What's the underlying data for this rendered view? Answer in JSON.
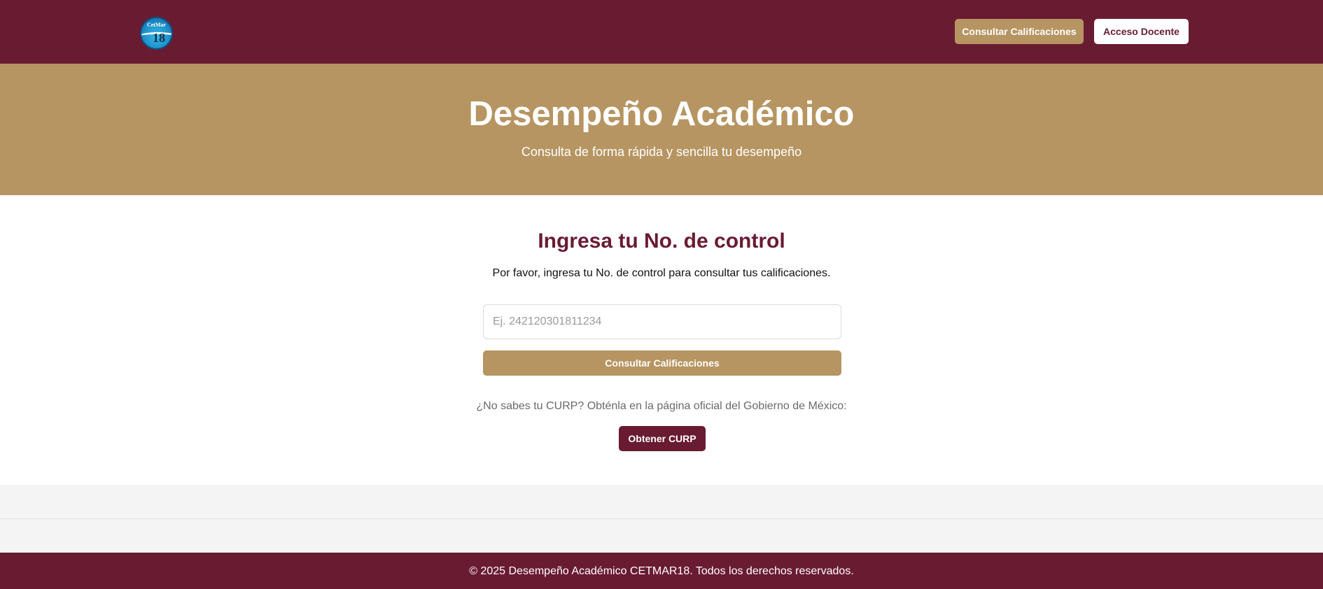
{
  "header": {
    "logo": {
      "icon": "cetmar-logo",
      "text": "CetMar",
      "number": "18"
    },
    "nav": {
      "grades_label": "Consultar Calificaciones",
      "teacher_label": "Acceso Docente"
    }
  },
  "hero": {
    "title": "Desempeño Académico",
    "subtitle": "Consulta de forma rápida y sencilla tu desempeño"
  },
  "form": {
    "heading": "Ingresa tu No. de control",
    "description": "Por favor, ingresa tu No. de control para consultar tus calificaciones.",
    "input_placeholder": "Ej. 242120301811234",
    "input_value": "",
    "submit_label": "Consultar Calificaciones"
  },
  "curp": {
    "text": "¿No sabes tu CURP? Obténla en la página oficial del Gobierno de México:",
    "button_label": "Obtener CURP"
  },
  "footer": {
    "text": "© 2025 Desempeño Académico CETMAR18. Todos los derechos reservados."
  },
  "colors": {
    "primary": "#691b32",
    "accent": "#b69562",
    "background": "#ffffff",
    "band": "#f4f4f4"
  }
}
